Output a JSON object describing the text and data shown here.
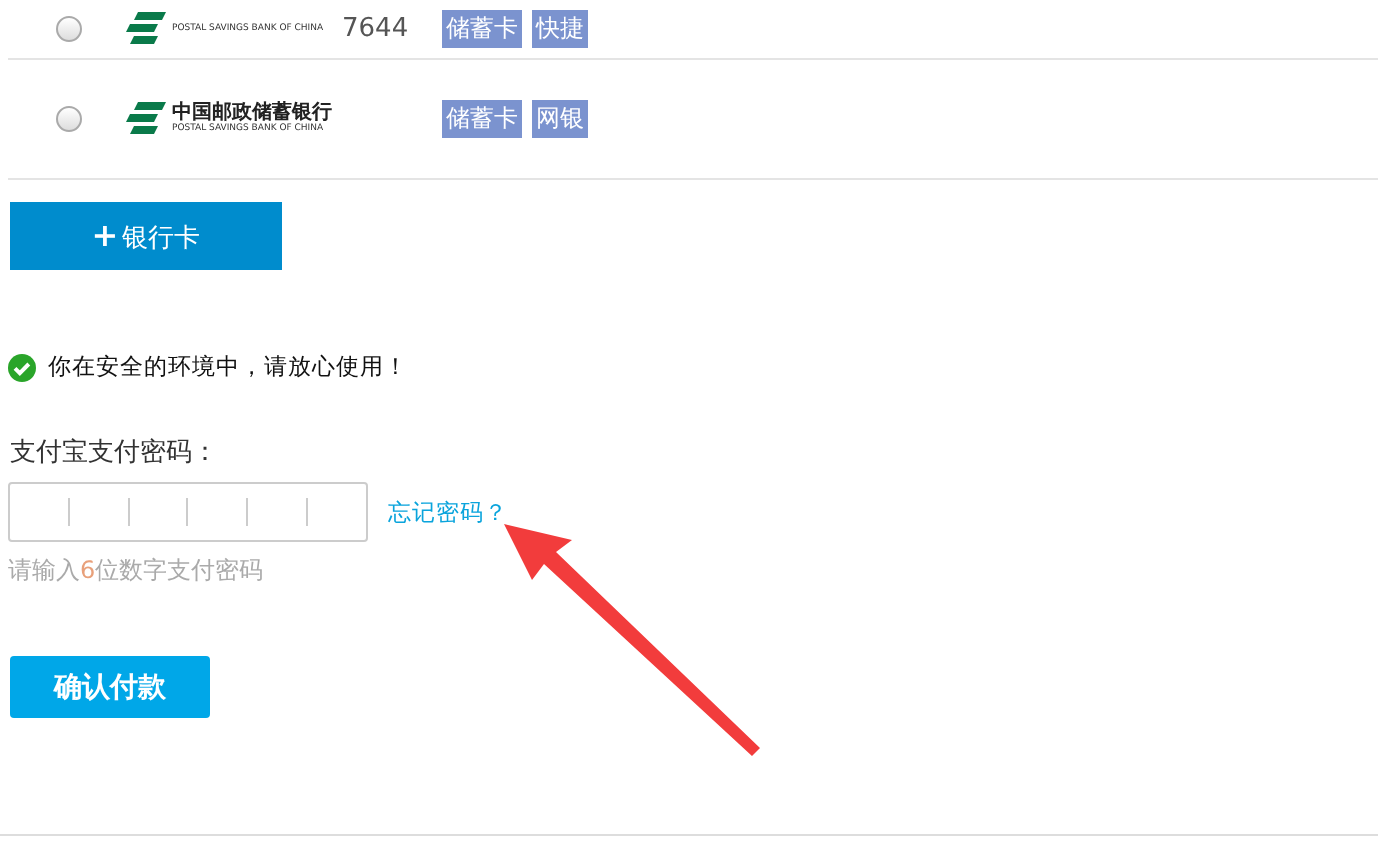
{
  "bank_rows": [
    {
      "selected": false,
      "bank_name_en": "POSTAL SAVINGS BANK OF CHINA",
      "card_number": "7644",
      "tags": [
        "储蓄卡",
        "快捷"
      ]
    },
    {
      "selected": false,
      "bank_name": "中国邮政储蓄银行",
      "bank_name_en": "POSTAL SAVINGS BANK OF CHINA",
      "tags": [
        "储蓄卡",
        "网银"
      ]
    }
  ],
  "add_card_button": {
    "icon": "+",
    "label": "银行卡"
  },
  "security_notice": "你在安全的环境中，请放心使用！",
  "password": {
    "label": "支付宝支付密码：",
    "forgot_link": "忘记密码？",
    "hint_before": "请输入",
    "hint_number": "6",
    "hint_after": "位数字支付密码"
  },
  "confirm_button": "确认付款"
}
